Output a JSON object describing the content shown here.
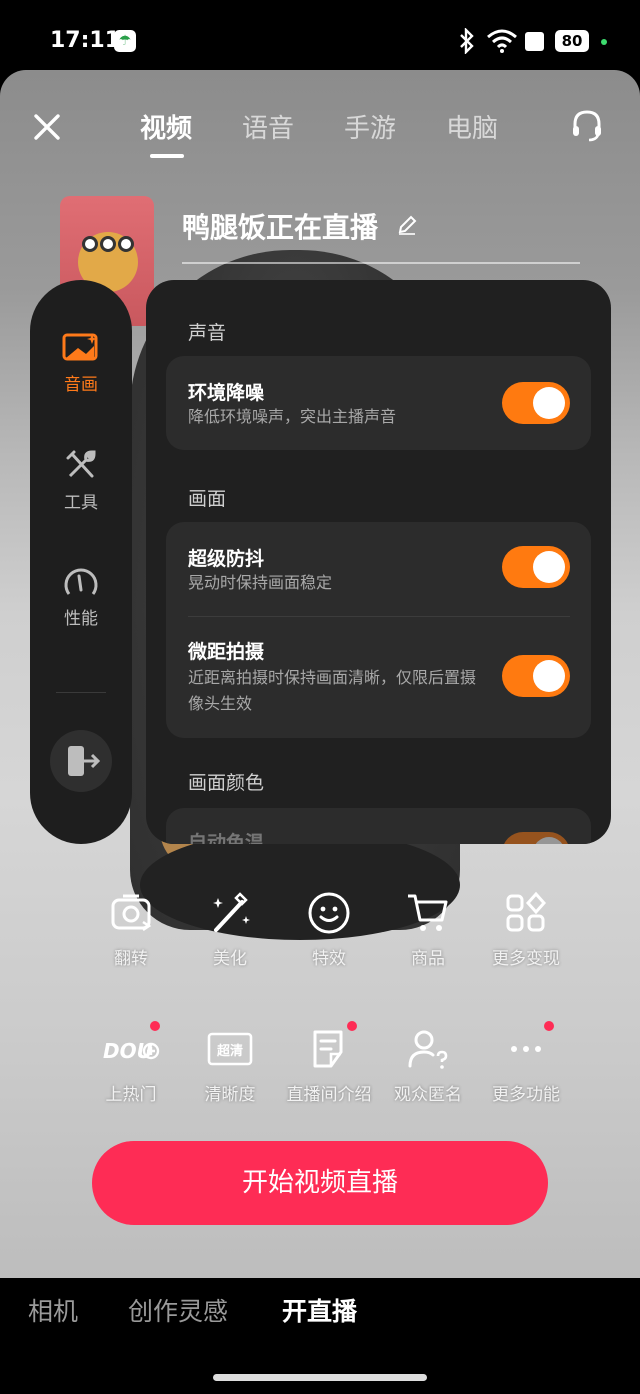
{
  "status_bar": {
    "time": "17:11",
    "battery": "80"
  },
  "top_tabs": [
    {
      "label": "视频",
      "active": true
    },
    {
      "label": "语音",
      "active": false
    },
    {
      "label": "手游",
      "active": false
    },
    {
      "label": "电脑",
      "active": false
    }
  ],
  "live_title": "鸭腿饭正在直播",
  "rail": {
    "items": [
      {
        "label": "音画",
        "icon": "picture-sound-icon",
        "active": true
      },
      {
        "label": "工具",
        "icon": "tools-icon",
        "active": false
      },
      {
        "label": "性能",
        "icon": "gauge-icon",
        "active": false
      }
    ],
    "exit_icon": "exit-icon"
  },
  "panel": {
    "sections": [
      {
        "title": "声音",
        "rows": [
          {
            "title": "环境降噪",
            "subtitle": "降低环境噪声，突出主播声音",
            "enabled": true
          }
        ]
      },
      {
        "title": "画面",
        "rows": [
          {
            "title": "超级防抖",
            "subtitle": "晃动时保持画面稳定",
            "enabled": true
          },
          {
            "title": "微距拍摄",
            "subtitle": "近距离拍摄时保持画面清晰，仅限后置摄像头生效",
            "enabled": true
          }
        ]
      },
      {
        "title": "画面颜色",
        "rows": [
          {
            "title": "自动色温",
            "enabled": true
          }
        ]
      }
    ]
  },
  "tools_row1": [
    {
      "label": "翻转",
      "icon": "flip-camera-icon"
    },
    {
      "label": "美化",
      "icon": "beautify-wand-icon"
    },
    {
      "label": "特效",
      "icon": "effects-smile-icon"
    },
    {
      "label": "商品",
      "icon": "shopping-cart-icon"
    },
    {
      "label": "更多变现",
      "icon": "monetize-grid-icon"
    }
  ],
  "tools_row2": [
    {
      "label": "上热门",
      "icon": "dou-plus-icon",
      "badge": true,
      "icon_text": "DOU+"
    },
    {
      "label": "清晰度",
      "icon": "resolution-icon",
      "badge": false,
      "icon_text": "超清"
    },
    {
      "label": "直播间介绍",
      "icon": "room-intro-icon",
      "badge": true
    },
    {
      "label": "观众匿名",
      "icon": "anonymous-viewer-icon",
      "badge": false
    },
    {
      "label": "更多功能",
      "icon": "more-dots-icon",
      "badge": true
    }
  ],
  "start_button": "开始视频直播",
  "bottom_nav": [
    {
      "label": "相机",
      "active": false
    },
    {
      "label": "创作灵感",
      "active": false
    },
    {
      "label": "开直播",
      "active": true
    }
  ],
  "colors": {
    "accent": "#ff7a10",
    "primary": "#fe2c55",
    "panel": "#202020"
  }
}
